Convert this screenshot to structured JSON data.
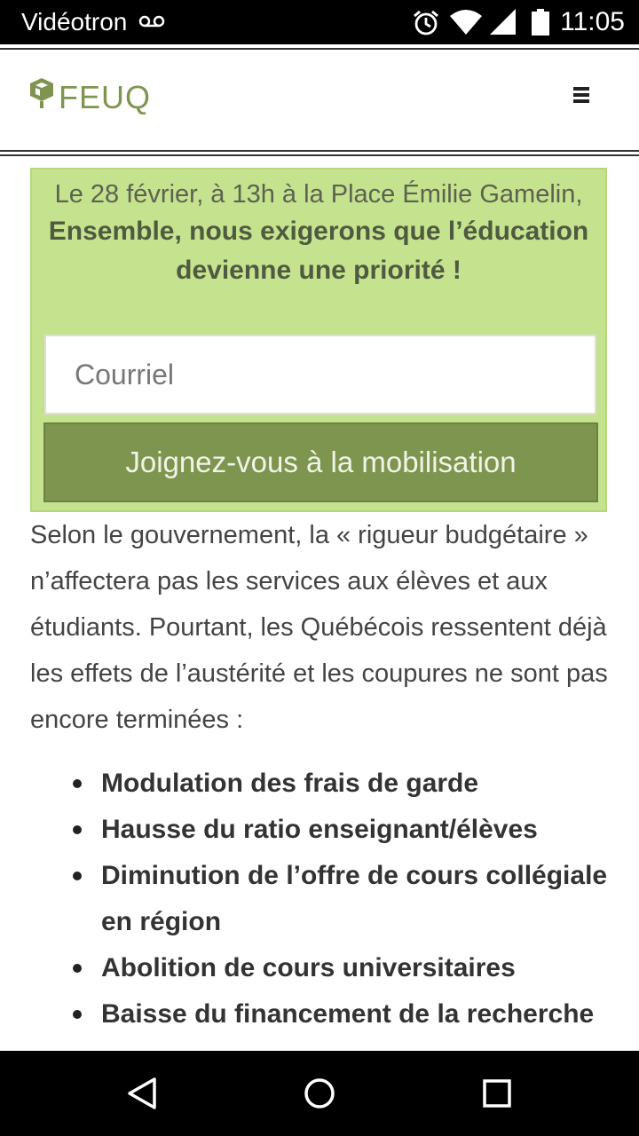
{
  "status_bar": {
    "carrier": "Vidéotron",
    "time": "11:05",
    "icons": [
      "voicemail-icon",
      "alarm-icon",
      "wifi-icon",
      "signal-icon",
      "battery-icon"
    ]
  },
  "header": {
    "logo_text": "FEUQ",
    "brand_color": "#7e9550",
    "menu_icon": "hamburger-menu-icon"
  },
  "signup_panel": {
    "date_line": "Le 28 février, à 13h à la Place Émilie Gamelin,",
    "headline_line1": "Ensemble, nous exigerons que l’éducation",
    "headline_line2": "devienne une priorité !",
    "email_placeholder": "Courriel",
    "join_label": "Joignez-vous à la mobilisation",
    "panel_color": "#c5e38f"
  },
  "article": {
    "intro": "Selon le gouvernement, la « rigueur budgétaire » n’affectera pas les services aux élèves et aux étudiants. Pourtant, les Québécois ressentent déjà les effets de l’austérité et les coupures ne sont pas encore terminées :",
    "cuts": [
      "Modulation des frais de garde",
      "Hausse du ratio enseignant/élèves",
      "Diminution de l’offre de cours collégiale en région",
      "Abolition de cours universitaires",
      "Baisse du financement de la recherche"
    ]
  },
  "nav_bar": {
    "icons": [
      "back-icon",
      "home-icon",
      "recents-icon"
    ]
  }
}
